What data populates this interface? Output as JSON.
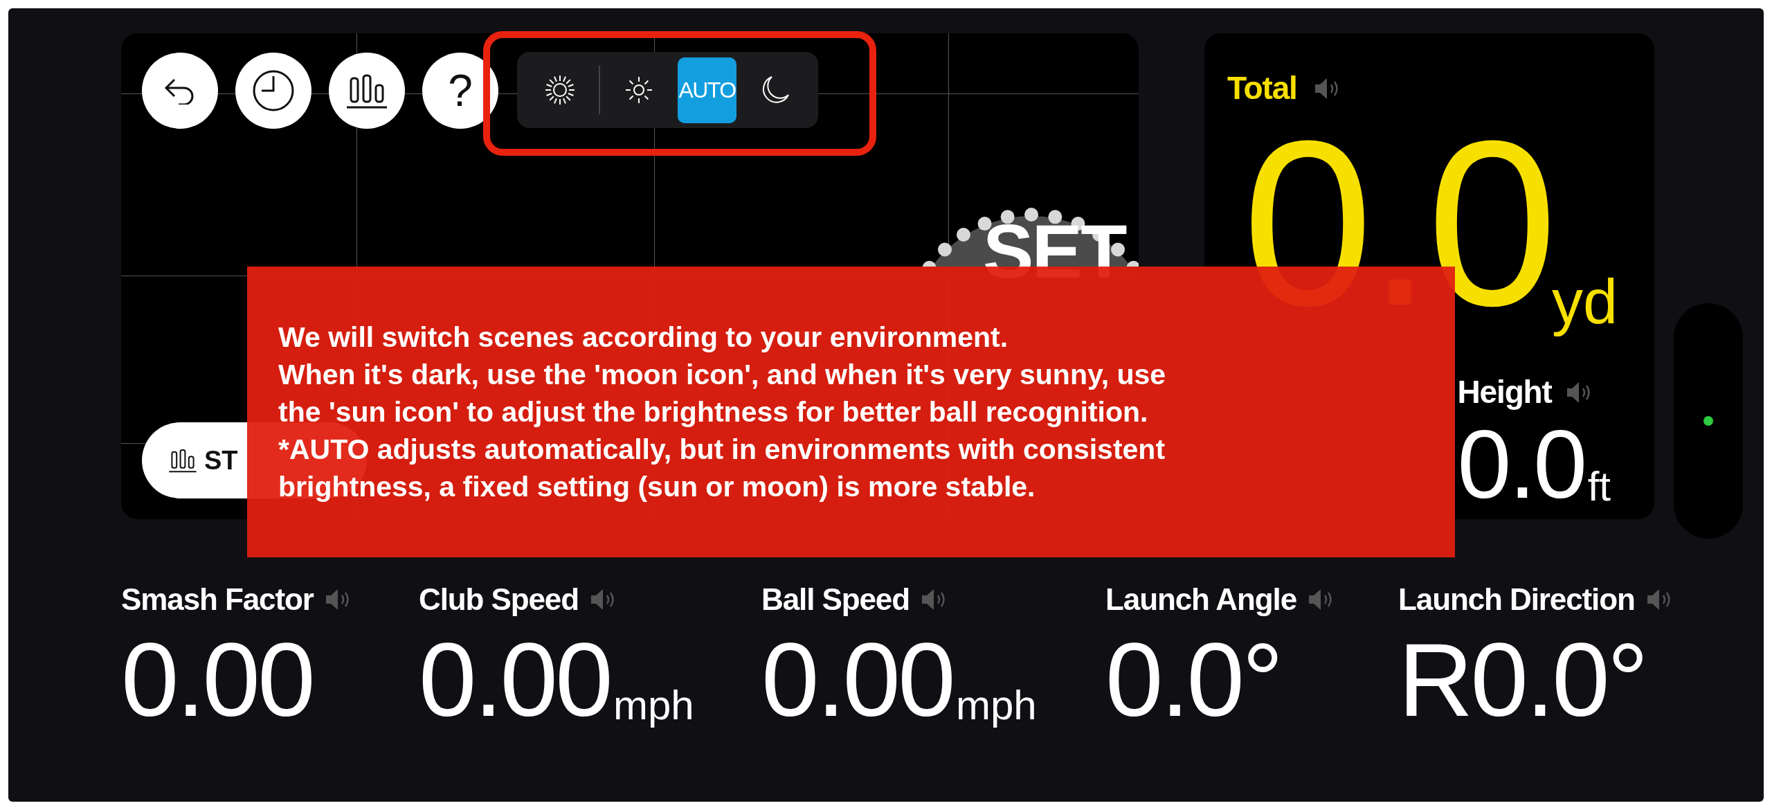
{
  "round_buttons": [
    {
      "kind": "back"
    },
    {
      "kind": "history"
    },
    {
      "kind": "stats"
    },
    {
      "kind": "help",
      "label": "?"
    }
  ],
  "brightness_modes": [
    {
      "kind": "bright_sun",
      "selected": false
    },
    {
      "kind": "sun",
      "selected": false
    },
    {
      "kind": "auto",
      "label": "AUTO",
      "selected": true
    },
    {
      "kind": "moon",
      "selected": false
    }
  ],
  "start_button": {
    "label": "ST"
  },
  "target": {
    "label": "SET"
  },
  "total": {
    "label": "Total",
    "value": "0.0",
    "unit": "yd"
  },
  "height": {
    "label": "Height",
    "value": "0.0",
    "unit": "ft"
  },
  "tooltip": {
    "text": "We will switch scenes according to your environment.\nWhen it's dark, use the 'moon icon', and when it's very sunny, use\nthe 'sun icon' to adjust the brightness for better ball recognition.\n*AUTO adjusts automatically, but in environments with consistent\nbrightness, a fixed setting (sun or moon) is more stable."
  },
  "metrics": [
    {
      "label": "Smash Factor",
      "value": "0.00"
    },
    {
      "label": "Club Speed",
      "value": "0.00",
      "unit": "mph"
    },
    {
      "label": "Ball Speed",
      "value": "0.00",
      "unit": "mph"
    },
    {
      "label": "Launch Angle",
      "value": "0.0°"
    },
    {
      "label": "Launch Direction",
      "value": "R0.0°"
    }
  ]
}
